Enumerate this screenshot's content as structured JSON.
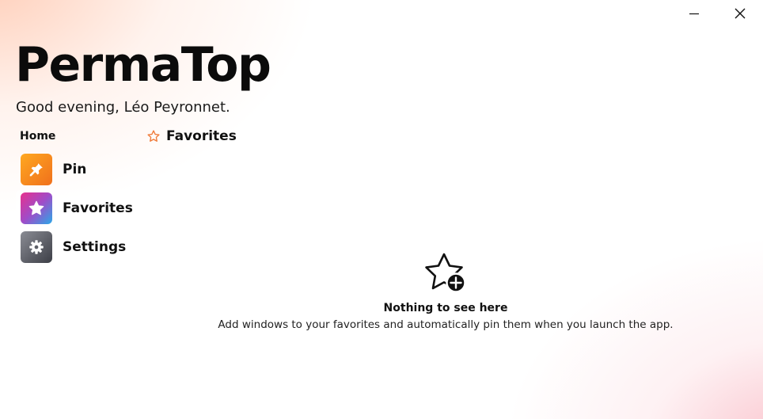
{
  "app": {
    "title": "PermaTop",
    "greeting": "Good evening, Léo Peyronnet."
  },
  "window_controls": [
    {
      "icon": "minimize-icon"
    },
    {
      "icon": "close-icon"
    }
  ],
  "sidebar": {
    "heading": "Home",
    "items": [
      {
        "label": "Pin",
        "icon": "pin-icon",
        "active": false
      },
      {
        "label": "Favorites",
        "icon": "star-icon",
        "active": true
      },
      {
        "label": "Settings",
        "icon": "gear-icon",
        "active": false
      }
    ]
  },
  "main": {
    "section_title": "Favorites",
    "section_icon": "star-outline-icon",
    "empty_state": {
      "icon": "star-add-icon",
      "title": "Nothing to see here",
      "description": "Add windows to your favorites and automatically pin them when you launch the app."
    }
  },
  "colors": {
    "accent_orange": "#f07b3a",
    "pin_gradient": [
      "#ffa820",
      "#f0701c"
    ],
    "favorites_gradient": [
      "#e8308c",
      "#a04cc8",
      "#2aa8e8"
    ],
    "settings_gradient": [
      "#8a8c94",
      "#3c3e46"
    ]
  }
}
